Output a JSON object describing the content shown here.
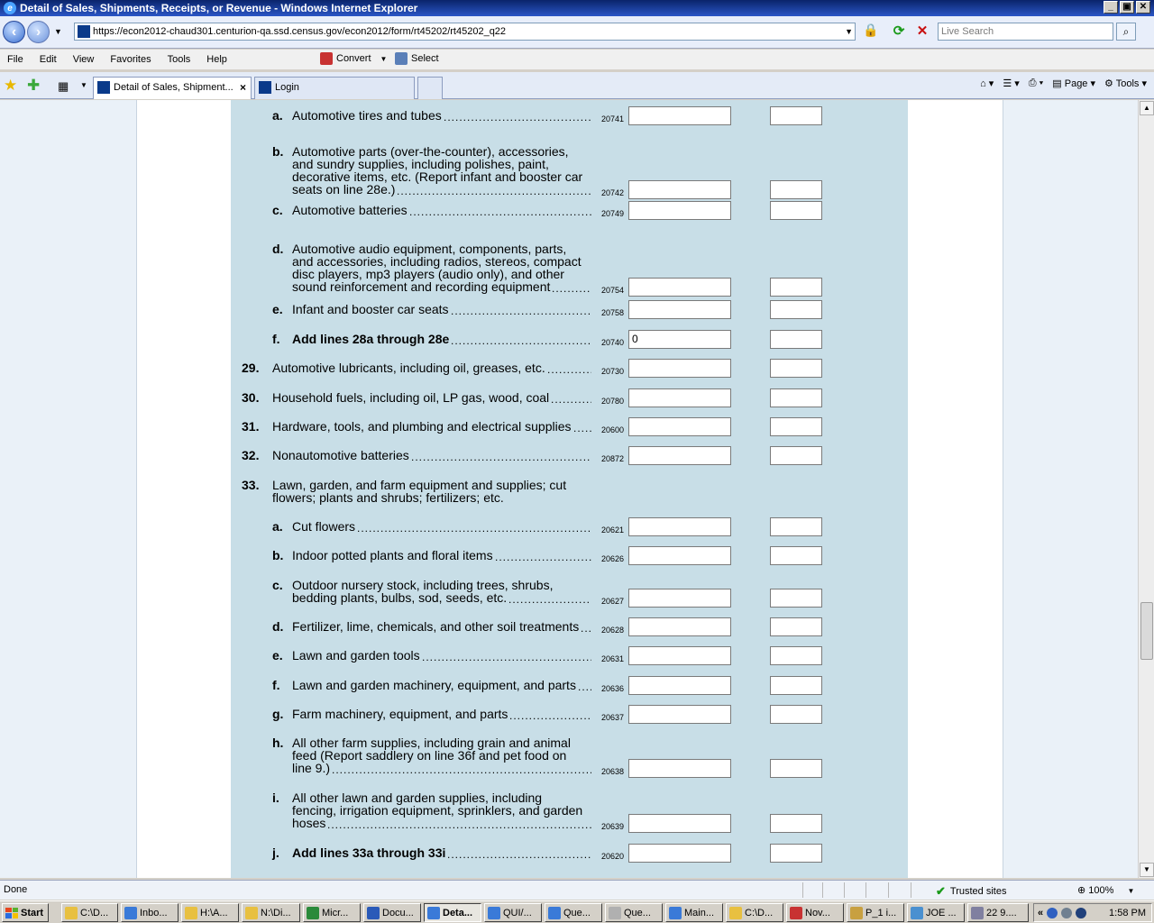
{
  "window": {
    "title": "Detail of Sales, Shipments, Receipts, or Revenue - Windows Internet Explorer",
    "min": "_",
    "max": "▣",
    "close": "✕"
  },
  "address": {
    "url": "https://econ2012-chaud301.centurion-qa.ssd.census.gov/econ2012/form/rt45202/rt45202_q22",
    "search_placeholder": "Live Search"
  },
  "menu": [
    "File",
    "Edit",
    "View",
    "Favorites",
    "Tools",
    "Help"
  ],
  "toolbar": {
    "convert": "Convert",
    "select": "Select"
  },
  "tabs": [
    {
      "label": "Detail of Sales, Shipment..."
    },
    {
      "label": "Login"
    }
  ],
  "commands": {
    "page": "Page",
    "tools": "Tools"
  },
  "form": {
    "rows": [
      {
        "num": "",
        "letter": "a.",
        "lines": [
          "Automotive tires and tubes"
        ],
        "code": "20741",
        "value": "",
        "bold": false
      },
      {
        "num": "",
        "letter": "b.",
        "lines": [
          "Automotive parts (over-the-counter), accessories,",
          "and sundry supplies, including polishes, paint,",
          "decorative items, etc. (Report infant and booster car",
          "seats on line 28e.)"
        ],
        "code": "20742",
        "value": "",
        "bold": false
      },
      {
        "num": "",
        "letter": "c.",
        "lines": [
          "Automotive batteries"
        ],
        "code": "20749",
        "value": "",
        "bold": false
      },
      {
        "num": "",
        "letter": "d.",
        "lines": [
          "Automotive audio equipment, components, parts,",
          "and accessories, including radios, stereos, compact",
          "disc players, mp3 players (audio only), and other",
          "sound reinforcement and recording equipment"
        ],
        "code": "20754",
        "value": "",
        "bold": false
      },
      {
        "num": "",
        "letter": "e.",
        "lines": [
          "Infant and booster car seats"
        ],
        "code": "20758",
        "value": "",
        "bold": false
      },
      {
        "num": "",
        "letter": "f.",
        "lines": [
          "Add lines 28a through 28e"
        ],
        "code": "20740",
        "value": "0",
        "bold": true
      },
      {
        "num": "29.",
        "letter": "",
        "lines": [
          "Automotive lubricants, including oil, greases, etc."
        ],
        "code": "20730",
        "value": "",
        "bold": false
      },
      {
        "num": "30.",
        "letter": "",
        "lines": [
          "Household fuels, including oil, LP gas, wood, coal"
        ],
        "code": "20780",
        "value": "",
        "bold": false
      },
      {
        "num": "31.",
        "letter": "",
        "lines": [
          "Hardware, tools, and plumbing and electrical supplies"
        ],
        "code": "20600",
        "value": "",
        "bold": false
      },
      {
        "num": "32.",
        "letter": "",
        "lines": [
          "Nonautomotive batteries"
        ],
        "code": "20872",
        "value": "",
        "bold": false
      },
      {
        "num": "33.",
        "letter": "",
        "lines": [
          "Lawn, garden, and farm equipment and supplies; cut",
          "flowers; plants and shrubs; fertilizers; etc."
        ],
        "code": "",
        "value": "",
        "bold": false,
        "header": true
      },
      {
        "num": "",
        "letter": "a.",
        "lines": [
          "Cut flowers"
        ],
        "code": "20621",
        "value": "",
        "bold": false
      },
      {
        "num": "",
        "letter": "b.",
        "lines": [
          "Indoor potted plants and floral items"
        ],
        "code": "20626",
        "value": "",
        "bold": false
      },
      {
        "num": "",
        "letter": "c.",
        "lines": [
          "Outdoor nursery stock, including trees, shrubs,",
          "bedding plants, bulbs, sod, seeds, etc."
        ],
        "code": "20627",
        "value": "",
        "bold": false
      },
      {
        "num": "",
        "letter": "d.",
        "lines": [
          "Fertilizer, lime, chemicals, and other soil treatments"
        ],
        "code": "20628",
        "value": "",
        "bold": false
      },
      {
        "num": "",
        "letter": "e.",
        "lines": [
          "Lawn and garden tools"
        ],
        "code": "20631",
        "value": "",
        "bold": false
      },
      {
        "num": "",
        "letter": "f.",
        "lines": [
          "Lawn and garden machinery, equipment, and parts"
        ],
        "code": "20636",
        "value": "",
        "bold": false
      },
      {
        "num": "",
        "letter": "g.",
        "lines": [
          "Farm machinery, equipment, and parts"
        ],
        "code": "20637",
        "value": "",
        "bold": false
      },
      {
        "num": "",
        "letter": "h.",
        "lines": [
          "All other farm supplies, including grain and animal",
          "feed (Report saddlery on line 36f and pet food on",
          "line 9.)"
        ],
        "code": "20638",
        "value": "",
        "bold": false
      },
      {
        "num": "",
        "letter": "i.",
        "lines": [
          "All other lawn and garden supplies, including",
          "fencing, irrigation equipment, sprinklers, and garden",
          "hoses"
        ],
        "code": "20639",
        "value": "",
        "bold": false
      },
      {
        "num": "",
        "letter": "j.",
        "lines": [
          "Add lines 33a through 33i"
        ],
        "code": "20620",
        "value": "",
        "bold": true
      }
    ]
  },
  "status": {
    "text": "Done",
    "zone": "Trusted sites",
    "zoom": "100%"
  },
  "taskbar": {
    "start": "Start",
    "items": [
      "C:\\D...",
      "Inbo...",
      "H:\\A...",
      "N:\\Di...",
      "Micr...",
      "Docu...",
      "Deta...",
      "QUI/...",
      "Que...",
      "Que...",
      "Main...",
      "C:\\D...",
      "Nov...",
      "P_1 i...",
      "JOE ...",
      "22 9...."
    ],
    "clock": "1:58 PM"
  },
  "colors": {
    "form_bg": "#c8dee7",
    "side_bg": "#eaf1f8",
    "titlebar": "#0a246a"
  }
}
